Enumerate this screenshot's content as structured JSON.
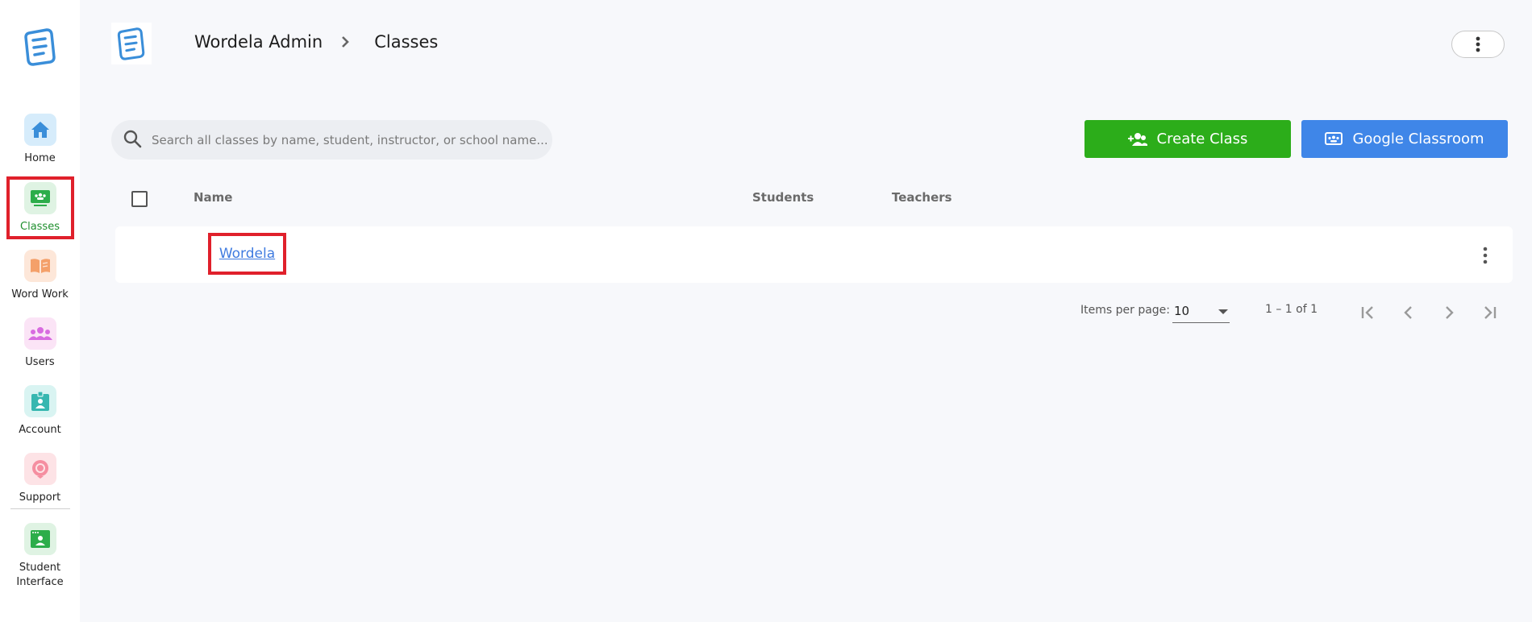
{
  "sidebar": {
    "items": [
      {
        "label": "Home"
      },
      {
        "label": "Classes"
      },
      {
        "label": "Word Work"
      },
      {
        "label": "Users"
      },
      {
        "label": "Account"
      },
      {
        "label": "Support"
      },
      {
        "label": "Student\nInterface"
      }
    ]
  },
  "breadcrumb": {
    "root": "Wordela Admin",
    "current": "Classes"
  },
  "search": {
    "placeholder": "Search all classes by name, student, instructor, or school name...",
    "value": ""
  },
  "actions": {
    "create_label": "Create Class",
    "google_label": "Google Classroom"
  },
  "table": {
    "columns": [
      "Name",
      "Students",
      "Teachers"
    ],
    "rows": [
      {
        "name": "Wordela",
        "students": "",
        "teachers": ""
      }
    ]
  },
  "pagination": {
    "items_per_page_label": "Items per page:",
    "items_per_page_value": "10",
    "range_label": "1 – 1 of 1"
  },
  "colors": {
    "accent_green": "#2cad1a",
    "accent_blue": "#3f86e8",
    "highlight_red": "#e0202b",
    "link_blue": "#3f7be0"
  }
}
